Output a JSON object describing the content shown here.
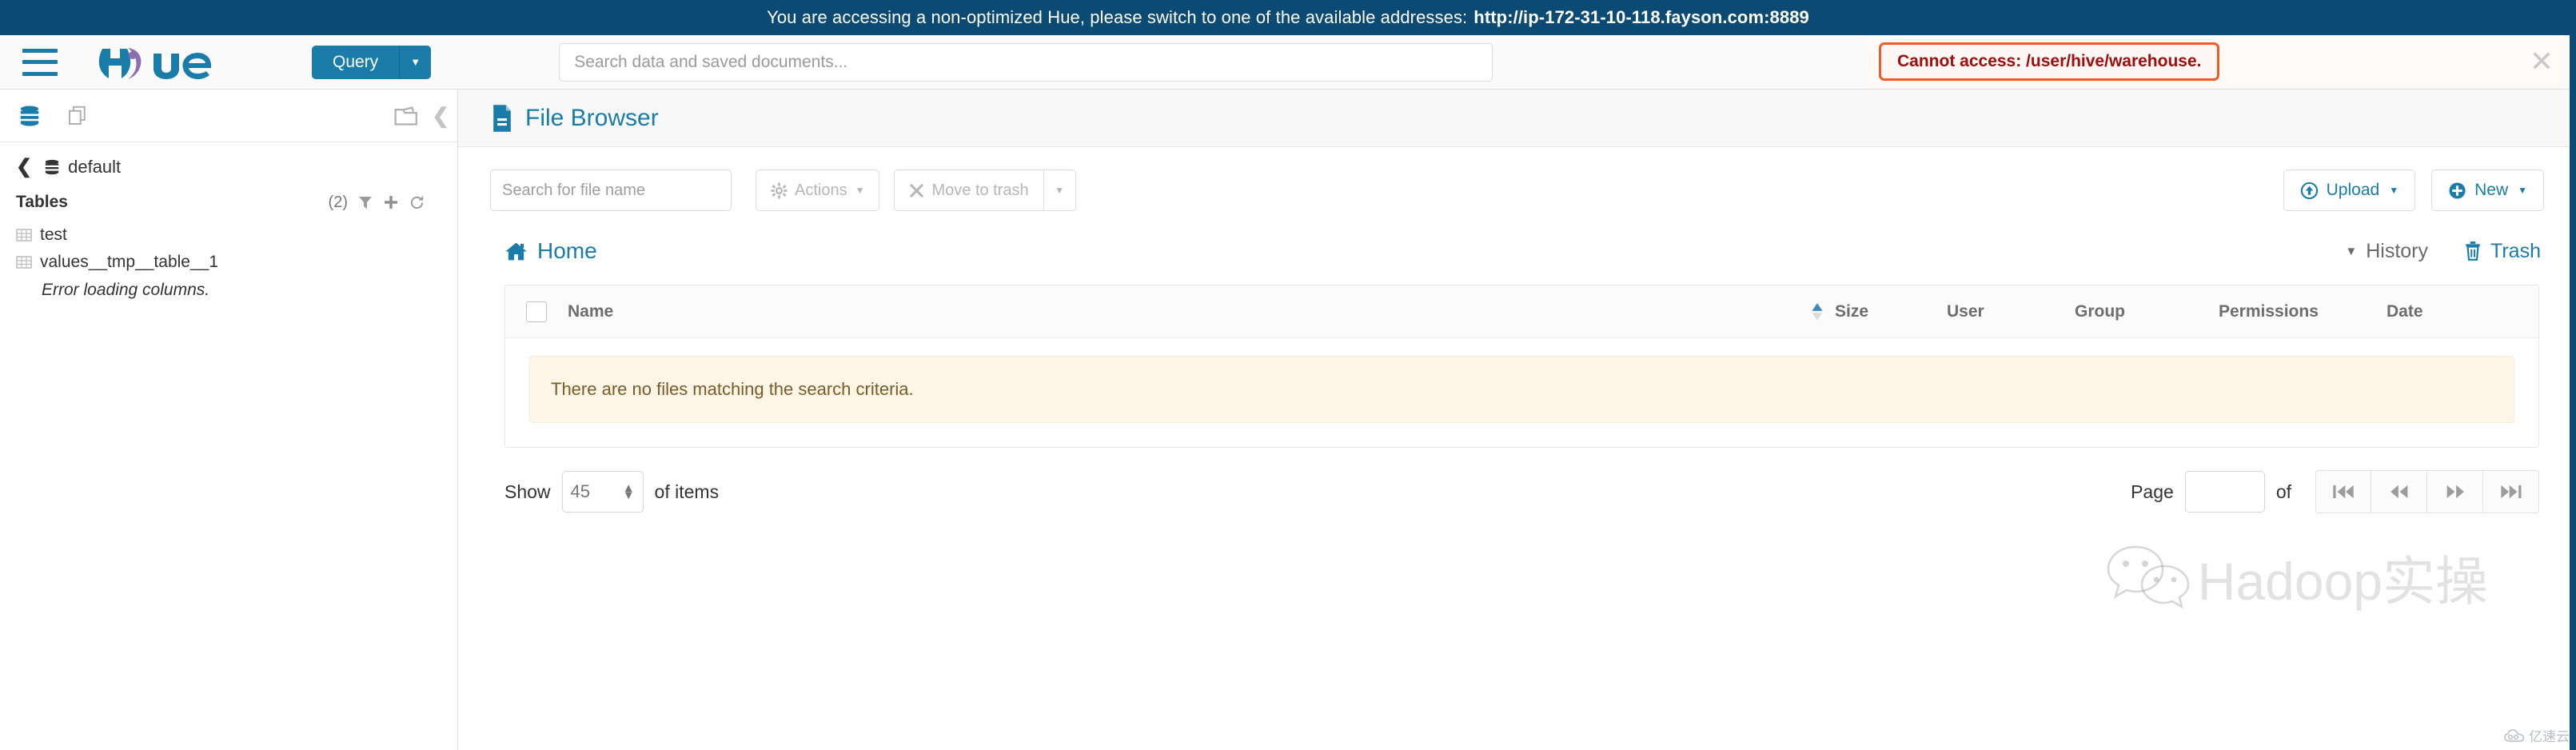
{
  "banner": {
    "message": "You are accessing a non-optimized Hue, please switch to one of the available addresses:",
    "url": "http://ip-172-31-10-118.fayson.com:8889"
  },
  "navbar": {
    "logo_alt": "Hue",
    "query_button": "Query",
    "search_placeholder": "Search data and saved documents..."
  },
  "toast": {
    "message": "Cannot access: /user/hive/warehouse.",
    "close_label": "✕",
    "border_color": "#f05a28",
    "text_color": "#a00d0d"
  },
  "assist": {
    "database": "default",
    "tables_label": "Tables",
    "tables_count": "(2)",
    "tables": [
      {
        "name": "test"
      },
      {
        "name": "values__tmp__table__1"
      }
    ],
    "error_text": "Error loading columns."
  },
  "page": {
    "title": "File Browser"
  },
  "toolbar": {
    "search_placeholder": "Search for file name",
    "actions_label": "Actions",
    "move_to_trash_label": "Move to trash",
    "upload_label": "Upload",
    "new_label": "New"
  },
  "breadcrumb": {
    "home_label": "Home",
    "history_label": "History",
    "trash_label": "Trash"
  },
  "file_table": {
    "columns": [
      "Name",
      "Size",
      "User",
      "Group",
      "Permissions",
      "Date"
    ],
    "sorted_column": "Size",
    "sort_direction": "asc",
    "rows": [],
    "empty_message": "There are no files matching the search criteria."
  },
  "pagination": {
    "show_label": "Show",
    "page_size": "45",
    "of_items_label": "of items",
    "page_label": "Page",
    "page_value": "",
    "of_label": "of",
    "first_label": "⏮",
    "prev_label": "⏪",
    "next_label": "⏩",
    "last_label": "⏭"
  },
  "watermarks": {
    "main": "Hadoop实操",
    "corner": "亿速云"
  },
  "colors": {
    "banner_bg": "#0b4a72",
    "accent_teal": "#1a7ca8",
    "warning_bg": "#fdf6e7",
    "warning_text": "#7a5c28"
  }
}
